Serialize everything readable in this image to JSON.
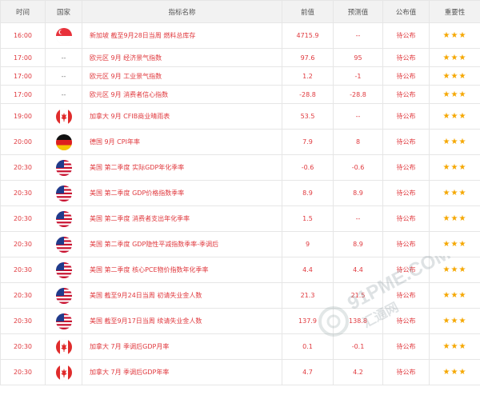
{
  "headers": {
    "time": "时间",
    "country": "国家",
    "name": "指标名称",
    "previous": "前值",
    "forecast": "预测值",
    "actual": "公布值",
    "importance": "重要性"
  },
  "rows": [
    {
      "time": "16:00",
      "flag": "singapore-flag",
      "country_text": "",
      "name": "新加坡 截至9月28日当周 燃料总库存",
      "previous": "4715.9",
      "forecast": "--",
      "actual": "待公布",
      "stars": "★★★"
    },
    {
      "time": "17:00",
      "flag": "",
      "country_text": "--",
      "name": "欧元区 9月 经济景气指数",
      "previous": "97.6",
      "forecast": "95",
      "actual": "待公布",
      "stars": "★★★"
    },
    {
      "time": "17:00",
      "flag": "",
      "country_text": "--",
      "name": "欧元区 9月 工业景气指数",
      "previous": "1.2",
      "forecast": "-1",
      "actual": "待公布",
      "stars": "★★★"
    },
    {
      "time": "17:00",
      "flag": "",
      "country_text": "--",
      "name": "欧元区 9月 消费者信心指数",
      "previous": "-28.8",
      "forecast": "-28.8",
      "actual": "待公布",
      "stars": "★★★"
    },
    {
      "time": "19:00",
      "flag": "canada-flag",
      "country_text": "",
      "name": "加拿大 9月 CFIB商业晴雨表",
      "previous": "53.5",
      "forecast": "--",
      "actual": "待公布",
      "stars": "★★★"
    },
    {
      "time": "20:00",
      "flag": "germany-flag",
      "country_text": "",
      "name": "德国 9月 CPI年率",
      "previous": "7.9",
      "forecast": "8",
      "actual": "待公布",
      "stars": "★★★"
    },
    {
      "time": "20:30",
      "flag": "usa-flag",
      "country_text": "",
      "name": "美国 第二季度 实际GDP年化季率",
      "previous": "-0.6",
      "forecast": "-0.6",
      "actual": "待公布",
      "stars": "★★★"
    },
    {
      "time": "20:30",
      "flag": "usa-flag",
      "country_text": "",
      "name": "美国 第二季度 GDP价格指数季率",
      "previous": "8.9",
      "forecast": "8.9",
      "actual": "待公布",
      "stars": "★★★"
    },
    {
      "time": "20:30",
      "flag": "usa-flag",
      "country_text": "",
      "name": "美国 第二季度 消费者支出年化季率",
      "previous": "1.5",
      "forecast": "--",
      "actual": "待公布",
      "stars": "★★★"
    },
    {
      "time": "20:30",
      "flag": "usa-flag",
      "country_text": "",
      "name": "美国 第二季度 GDP隐性平减指数季率-季调后",
      "previous": "9",
      "forecast": "8.9",
      "actual": "待公布",
      "stars": "★★★"
    },
    {
      "time": "20:30",
      "flag": "usa-flag",
      "country_text": "",
      "name": "美国 第二季度 核心PCE物价指数年化季率",
      "previous": "4.4",
      "forecast": "4.4",
      "actual": "待公布",
      "stars": "★★★"
    },
    {
      "time": "20:30",
      "flag": "usa-flag",
      "country_text": "",
      "name": "美国 截至9月24日当周 初请失业金人数",
      "previous": "21.3",
      "forecast": "21.5",
      "actual": "待公布",
      "stars": "★★★"
    },
    {
      "time": "20:30",
      "flag": "usa-flag",
      "country_text": "",
      "name": "美国 截至9月17日当周 续请失业金人数",
      "previous": "137.9",
      "forecast": "138.8",
      "actual": "待公布",
      "stars": "★★★"
    },
    {
      "time": "20:30",
      "flag": "canada-flag",
      "country_text": "",
      "name": "加拿大 7月 季调后GDP月率",
      "previous": "0.1",
      "forecast": "-0.1",
      "actual": "待公布",
      "stars": "★★★"
    },
    {
      "time": "20:30",
      "flag": "canada-flag",
      "country_text": "",
      "name": "加拿大 7月 季调后GDP年率",
      "previous": "4.7",
      "forecast": "4.2",
      "actual": "待公布",
      "stars": "★★★"
    }
  ],
  "watermark": {
    "text": "91PME.COM",
    "subtext": "汇通网",
    "logo": "91pme-logo-icon"
  },
  "colors": {
    "text": "#e0393e",
    "star": "#f5a700",
    "header_bg": "#f2f2f2",
    "border": "#e6e6e6"
  }
}
